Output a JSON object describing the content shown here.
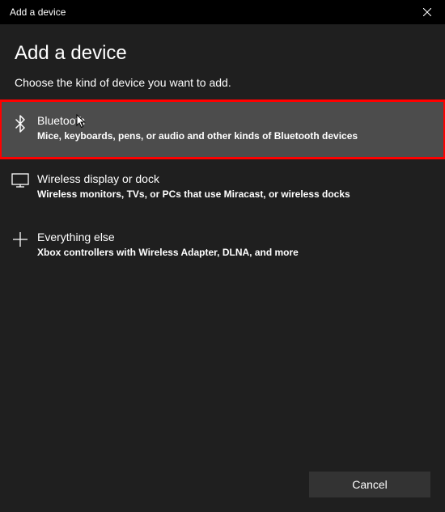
{
  "titlebar": {
    "title": "Add a device"
  },
  "header": {
    "title": "Add a device",
    "instruction": "Choose the kind of device you want to add."
  },
  "options": [
    {
      "title": "Bluetooth",
      "description": "Mice, keyboards, pens, or audio and other kinds of Bluetooth devices",
      "highlighted": true
    },
    {
      "title": "Wireless display or dock",
      "description": "Wireless monitors, TVs, or PCs that use Miracast, or wireless docks",
      "highlighted": false
    },
    {
      "title": "Everything else",
      "description": "Xbox controllers with Wireless Adapter, DLNA, and more",
      "highlighted": false
    }
  ],
  "footer": {
    "cancel_label": "Cancel"
  }
}
